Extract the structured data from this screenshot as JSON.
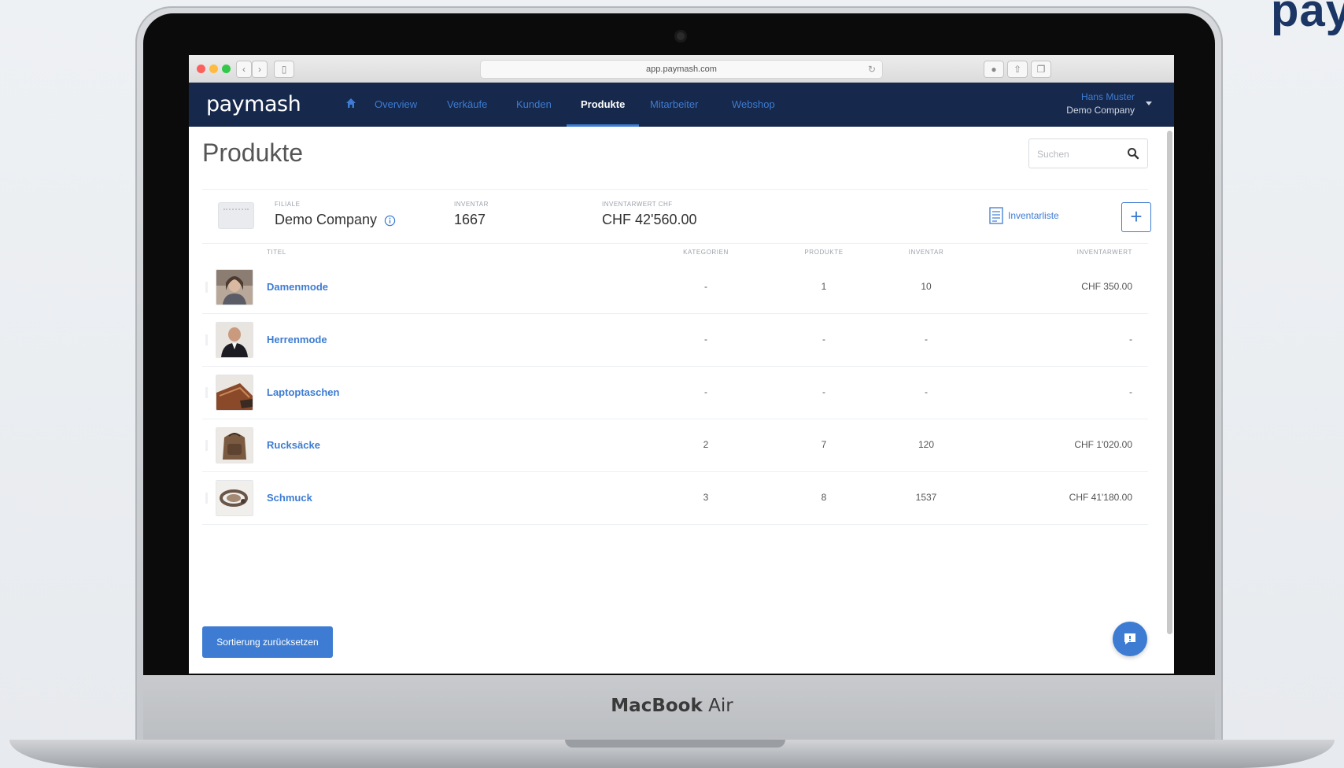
{
  "corner_logo": "pay",
  "device_label": {
    "brand": "MacBook",
    "model": "Air"
  },
  "browser": {
    "url": "app.paymash.com"
  },
  "app": {
    "brand": "paymash",
    "nav": [
      "Overview",
      "Verkäufe",
      "Kunden",
      "Produkte",
      "Mitarbeiter",
      "Webshop"
    ],
    "active_nav": "Produkte",
    "user": {
      "name": "Hans Muster",
      "company": "Demo Company"
    }
  },
  "page": {
    "title": "Produkte",
    "search": {
      "placeholder": "Suchen",
      "value": ""
    }
  },
  "summary": {
    "store_label": "FILIALE",
    "store_value": "Demo Company",
    "inventory_label": "INVENTAR",
    "inventory_value": "1667",
    "inventory_value_label": "INVENTARWERT CHF",
    "inventory_value_amount": "CHF 42'560.00",
    "inventory_list_label": "Inventarliste",
    "add_label": "+"
  },
  "table": {
    "headers": {
      "title": "TITEL",
      "categories": "KATEGORIEN",
      "products": "PRODUKTE",
      "inventory": "INVENTAR",
      "value": "INVENTARWERT"
    },
    "rows": [
      {
        "title": "Damenmode",
        "categories": "-",
        "products": "1",
        "inventory": "10",
        "value": "CHF 350.00",
        "image": "woman-portrait"
      },
      {
        "title": "Herrenmode",
        "categories": "-",
        "products": "-",
        "inventory": "-",
        "value": "-",
        "image": "man-portrait"
      },
      {
        "title": "Laptoptaschen",
        "categories": "-",
        "products": "-",
        "inventory": "-",
        "value": "-",
        "image": "laptop-bag"
      },
      {
        "title": "Rucksäcke",
        "categories": "2",
        "products": "7",
        "inventory": "120",
        "value": "CHF 1'020.00",
        "image": "backpack"
      },
      {
        "title": "Schmuck",
        "categories": "3",
        "products": "8",
        "inventory": "1537",
        "value": "CHF 41'180.00",
        "image": "jewelry"
      }
    ]
  },
  "reset_button": "Sortierung zurücksetzen",
  "colors": {
    "nav_bg": "#16284c",
    "accent": "#3d7cd2",
    "text": "#333333"
  }
}
